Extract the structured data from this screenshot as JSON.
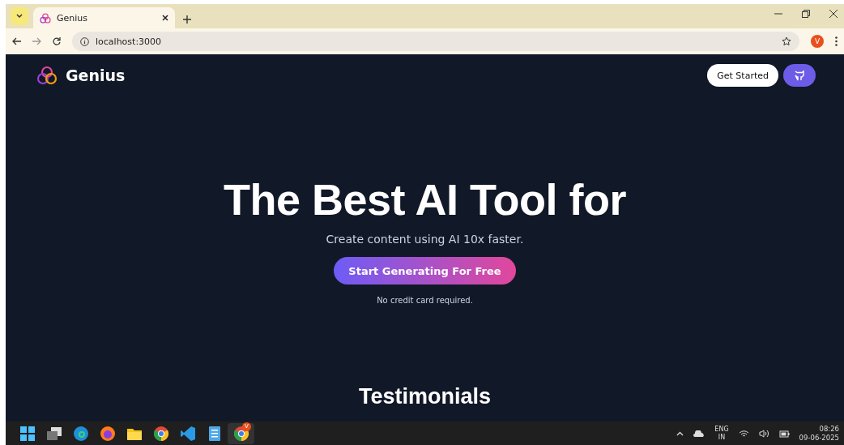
{
  "browser": {
    "tab_title": "Genius",
    "url": "localhost:3000",
    "profile_initial": "V"
  },
  "page": {
    "brand": "Genius",
    "nav_button": "Get Started",
    "hero_title": "The Best AI Tool for",
    "subtitle": "Create content using AI 10x faster.",
    "cta": "Start Generating For Free",
    "note": "No credit card required.",
    "section_title": "Testimonials"
  },
  "taskbar": {
    "apps": [
      {
        "kind": "start",
        "selected": false
      },
      {
        "kind": "taskview",
        "selected": false
      },
      {
        "kind": "edge",
        "selected": false
      },
      {
        "kind": "firefox",
        "selected": false
      },
      {
        "kind": "files",
        "selected": false
      },
      {
        "kind": "chrome",
        "selected": false
      },
      {
        "kind": "vscode",
        "selected": false
      },
      {
        "kind": "notepad",
        "selected": false
      },
      {
        "kind": "chrome",
        "selected": true,
        "badge": "V"
      }
    ],
    "language": "ENG",
    "region": "IN",
    "time": "08:26",
    "date": "09-06-2025"
  }
}
